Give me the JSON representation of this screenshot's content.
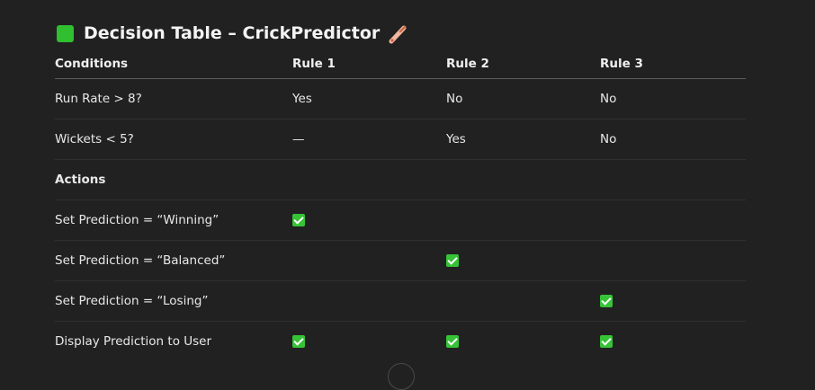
{
  "title": {
    "text": "Decision Table – CrickPredictor",
    "leading_icon": "green-square-icon",
    "trailing_icon": "cricket-bat-icon"
  },
  "table": {
    "headers": [
      "Conditions",
      "Rule 1",
      "Rule 2",
      "Rule 3"
    ],
    "condition_rows": [
      {
        "label": "Run Rate > 8?",
        "values": [
          "Yes",
          "No",
          "No"
        ]
      },
      {
        "label": "Wickets < 5?",
        "values": [
          "—",
          "Yes",
          "No"
        ]
      }
    ],
    "actions_heading": "Actions",
    "action_rows": [
      {
        "label": "Set Prediction = “Winning”",
        "checks": [
          true,
          false,
          false
        ]
      },
      {
        "label": "Set Prediction = “Balanced”",
        "checks": [
          false,
          true,
          false
        ]
      },
      {
        "label": "Set Prediction = “Losing”",
        "checks": [
          false,
          false,
          true
        ]
      },
      {
        "label": "Display Prediction to User",
        "checks": [
          true,
          true,
          true
        ]
      }
    ]
  },
  "colors": {
    "background": "#212121",
    "check_green": "#36c336",
    "text": "#ececec"
  }
}
